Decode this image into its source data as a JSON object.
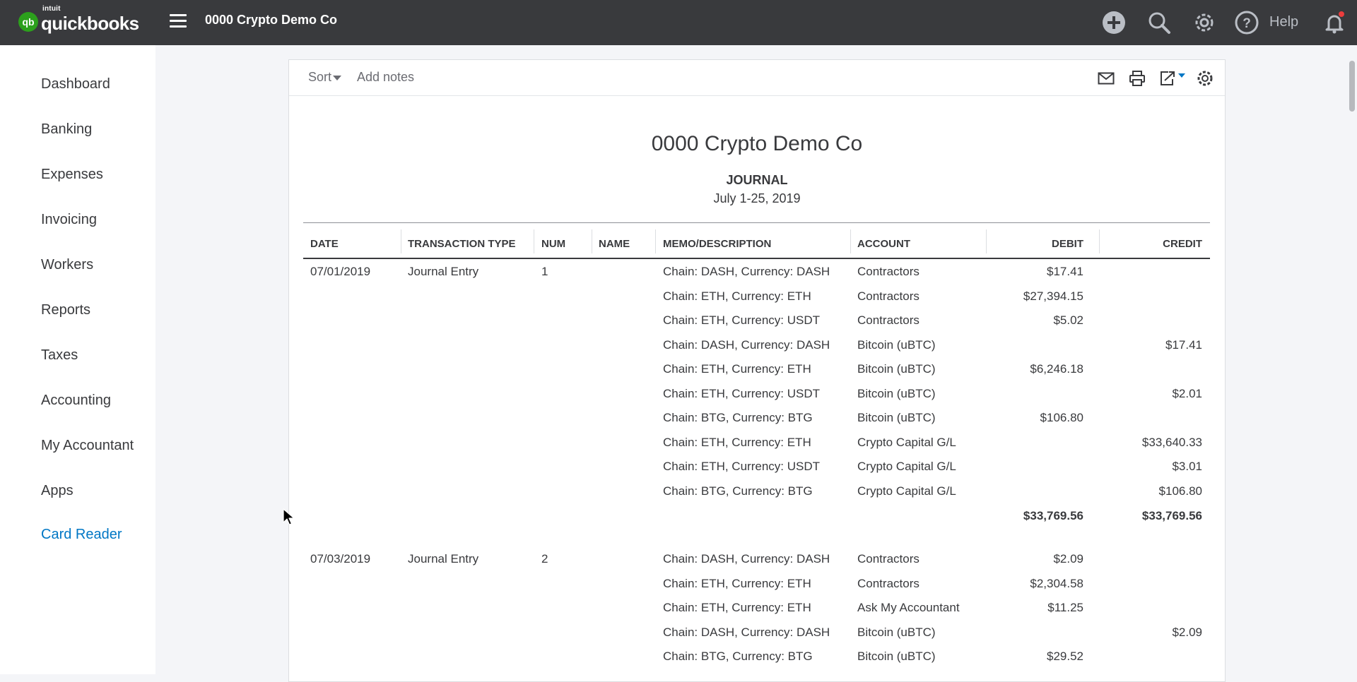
{
  "app": {
    "logo_intuit": "intuit",
    "logo_name": "quickbooks",
    "logo_mark": "qb",
    "company_name": "0000 Crypto Demo Co",
    "help_label": "Help",
    "brand_color": "#2ca01c",
    "topbar_color": "#393a3d",
    "link_color": "#0077c5"
  },
  "topbar_icons": [
    "plus-circle-icon",
    "search-icon",
    "gear-icon",
    "help-circle-icon",
    "bell-icon"
  ],
  "sidebar": {
    "items": [
      {
        "label": "Dashboard"
      },
      {
        "label": "Banking"
      },
      {
        "label": "Expenses"
      },
      {
        "label": "Invoicing"
      },
      {
        "label": "Workers"
      },
      {
        "label": "Reports"
      },
      {
        "label": "Taxes"
      },
      {
        "label": "Accounting"
      },
      {
        "label": "My Accountant"
      },
      {
        "label": "Apps"
      },
      {
        "label": "Card Reader"
      }
    ]
  },
  "report": {
    "toolbar": {
      "sort_label": "Sort",
      "notes_label": "Add notes",
      "icons": [
        "email-icon",
        "print-icon",
        "export-icon",
        "settings-gear-icon"
      ]
    },
    "company": "0000 Crypto Demo Co",
    "name": "JOURNAL",
    "date_range": "July 1-25, 2019",
    "columns": [
      "DATE",
      "TRANSACTION TYPE",
      "NUM",
      "NAME",
      "MEMO/DESCRIPTION",
      "ACCOUNT",
      "DEBIT",
      "CREDIT"
    ],
    "entries": [
      {
        "date": "07/01/2019",
        "type": "Journal Entry",
        "num": "1",
        "name": "",
        "lines": [
          {
            "memo": "Chain: DASH, Currency: DASH",
            "account": "Contractors",
            "debit": "$17.41",
            "credit": ""
          },
          {
            "memo": "Chain: ETH, Currency: ETH",
            "account": "Contractors",
            "debit": "$27,394.15",
            "credit": ""
          },
          {
            "memo": "Chain: ETH, Currency: USDT",
            "account": "Contractors",
            "debit": "$5.02",
            "credit": ""
          },
          {
            "memo": "Chain: DASH, Currency: DASH",
            "account": "Bitcoin (uBTC)",
            "debit": "",
            "credit": "$17.41"
          },
          {
            "memo": "Chain: ETH, Currency: ETH",
            "account": "Bitcoin (uBTC)",
            "debit": "$6,246.18",
            "credit": ""
          },
          {
            "memo": "Chain: ETH, Currency: USDT",
            "account": "Bitcoin (uBTC)",
            "debit": "",
            "credit": "$2.01"
          },
          {
            "memo": "Chain: BTG, Currency: BTG",
            "account": "Bitcoin (uBTC)",
            "debit": "$106.80",
            "credit": ""
          },
          {
            "memo": "Chain: ETH, Currency: ETH",
            "account": "Crypto Capital G/L",
            "debit": "",
            "credit": "$33,640.33"
          },
          {
            "memo": "Chain: ETH, Currency: USDT",
            "account": "Crypto Capital G/L",
            "debit": "",
            "credit": "$3.01"
          },
          {
            "memo": "Chain: BTG, Currency: BTG",
            "account": "Crypto Capital G/L",
            "debit": "",
            "credit": "$106.80"
          }
        ],
        "total_debit": "$33,769.56",
        "total_credit": "$33,769.56"
      },
      {
        "date": "07/03/2019",
        "type": "Journal Entry",
        "num": "2",
        "name": "",
        "lines": [
          {
            "memo": "Chain: DASH, Currency: DASH",
            "account": "Contractors",
            "debit": "$2.09",
            "credit": ""
          },
          {
            "memo": "Chain: ETH, Currency: ETH",
            "account": "Contractors",
            "debit": "$2,304.58",
            "credit": ""
          },
          {
            "memo": "Chain: ETH, Currency: ETH",
            "account": "Ask My Accountant",
            "debit": "$11.25",
            "credit": ""
          },
          {
            "memo": "Chain: DASH, Currency: DASH",
            "account": "Bitcoin (uBTC)",
            "debit": "",
            "credit": "$2.09"
          },
          {
            "memo": "Chain: BTG, Currency: BTG",
            "account": "Bitcoin (uBTC)",
            "debit": "$29.52",
            "credit": ""
          }
        ]
      }
    ]
  }
}
